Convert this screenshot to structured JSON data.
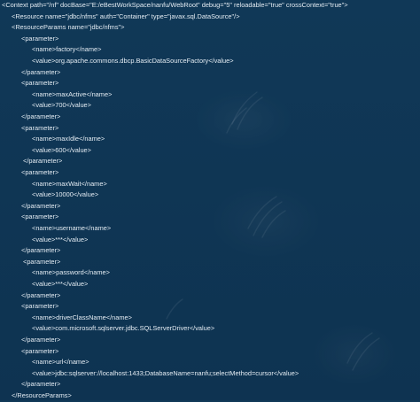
{
  "lines": [
    "<Context path=\"/nf\" docBase=\"E:/eBestWorkSpace/nanfu/WebRoot\" debug=\"5\" reloadable=\"true\" crossContext=\"true\">",
    "<Resource name=\"jdbc/nfms\" auth=\"Container\" type=\"javax.sql.DataSource\"/>",
    "<ResourceParams name=\"jdbc/nfms\">",
    "<parameter>",
    "<name>factory</name>",
    "<value>org.apache.commons.dbcp.BasicDataSourceFactory</value>",
    "</parameter>",
    "<parameter>",
    "<name>maxActive</name>",
    "<value>700</value>",
    "</parameter>",
    "<parameter>",
    "<name>maxIdle</name>",
    "<value>600</value>",
    "</parameter>",
    "<parameter>",
    "<name>maxWait</name>",
    "<value>10000</value>",
    "</parameter>",
    "<parameter>",
    "<name>username</name>",
    "<value>***</value>",
    "</parameter>",
    "<parameter>",
    "<name>password</name>",
    "<value>***</value>",
    "</parameter>",
    "<parameter>",
    "<name>driverClassName</name>",
    "<value>com.microsoft.sqlserver.jdbc.SQLServerDriver</value>",
    "</parameter>",
    "<parameter>",
    "<name>url</name>",
    "<value>jdbc:sqlserver://localhost:1433;DatabaseName=nanfu;selectMethod=cursor</value>",
    "</parameter>",
    "</ResourceParams>"
  ]
}
